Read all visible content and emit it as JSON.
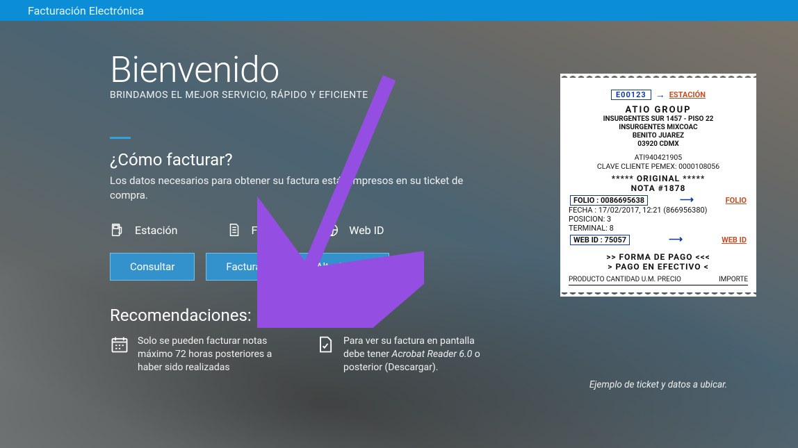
{
  "topbar": {
    "title": "Facturación Electrónica"
  },
  "hero": {
    "welcome": "Bienvenido",
    "tagline": "BRINDAMOS EL MEJOR SERVICIO, RÁPIDO Y EFICIENTE",
    "howto_title": "¿Cómo facturar?",
    "howto_desc": "Los datos necesarios para obtener su factura están impresos en su ticket de compra."
  },
  "fields": {
    "estacion": "Estación",
    "folio": "Folio",
    "webid": "Web ID"
  },
  "buttons": {
    "consultar": "Consultar",
    "facturar": "Facturar",
    "alta": "Alta Cliente"
  },
  "recs": {
    "title": "Recomendaciones:",
    "item1": "Solo se pueden facturar notas máximo 72 horas posteriores a haber sido realizadas",
    "item2_pre": "Para ver su factura en pantalla debe tener ",
    "item2_em": "Acrobat Reader 6.0",
    "item2_post": " o posterior (Descargar)."
  },
  "receipt": {
    "estacion_code": "E00123",
    "estacion_label": "ESTACIÓN",
    "company": "ATIO GROUP",
    "addr1": "INSURGENTES SUR 1457 - PISO 22",
    "addr2": "INSURGENTES MIXCOAC",
    "addr3": "BENITO JUAREZ",
    "addr4": "03920 CDMX",
    "rfc": "ATI940421905",
    "clave": "CLAVE CLIENTE PEMEX: 0000108056",
    "original": "***** ORIGINAL *****",
    "nota": "NOTA #1878",
    "folio_key": "FOLIO",
    "folio_val": "0086695638",
    "folio_label": "FOLIO",
    "fecha": "FECHA  : 17/02/2017, 12:21 (866956380)",
    "posicion": "POSICION: 3",
    "terminal": "TERMINAL: 8",
    "webid_key": "WEB ID",
    "webid_val": "75057",
    "webid_label": "WEB ID",
    "forma": ">> FORMA DE PAGO <<<",
    "pago": "> PAGO EN EFECTIVO <",
    "prod_hdr_left": "PRODUCTO CANTIDAD U.M. PRECIO",
    "prod_hdr_right": "IMPORTE"
  },
  "caption": "Ejemplo de ticket y datos a ubicar."
}
